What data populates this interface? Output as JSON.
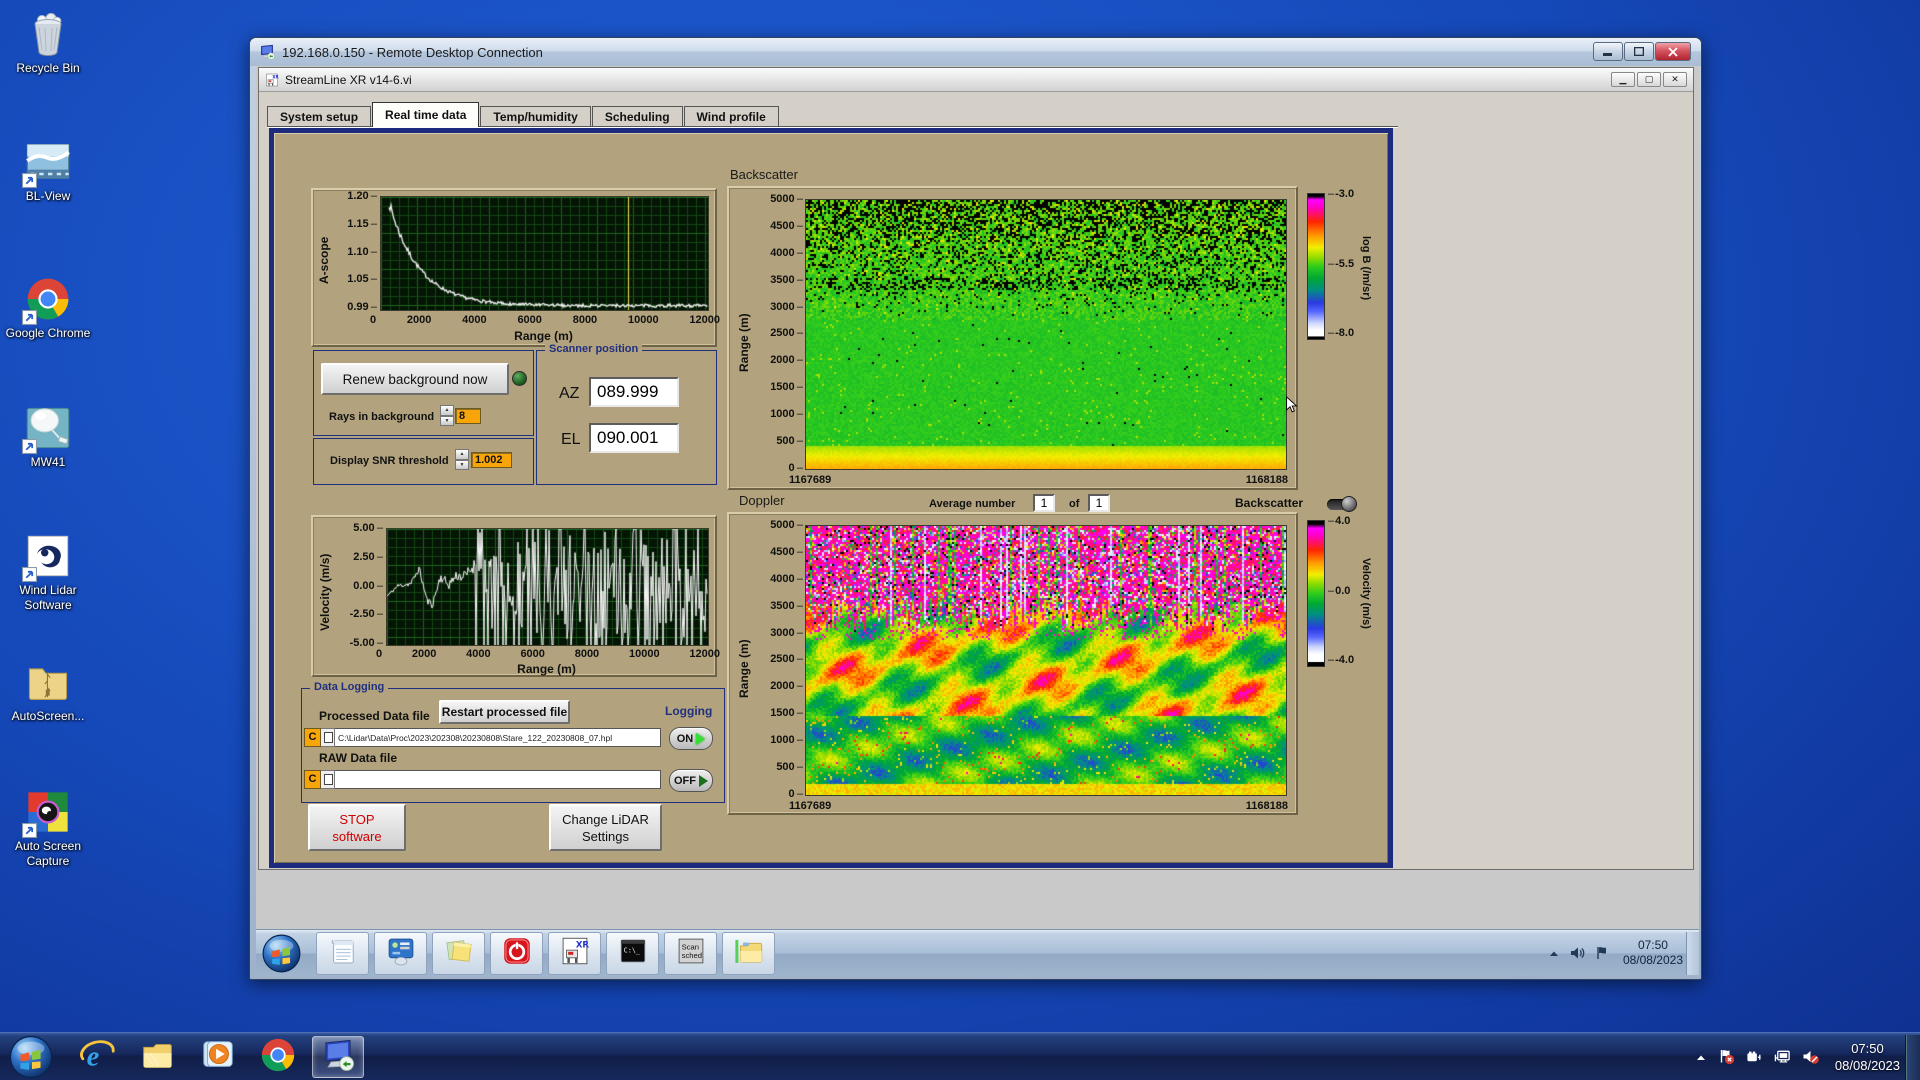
{
  "desktop": {
    "icons": [
      {
        "label": "Recycle Bin",
        "icon": "recycle-bin-icon",
        "shortcut": false,
        "top": 10
      },
      {
        "label": "BL-View",
        "icon": "bl-view-icon",
        "shortcut": true,
        "top": 138
      },
      {
        "label": "Google Chrome",
        "icon": "chrome-icon",
        "shortcut": true,
        "top": 275
      },
      {
        "label": "MW41",
        "icon": "mw41-icon",
        "shortcut": true,
        "top": 404
      },
      {
        "label": "Wind Lidar Software",
        "icon": "wind-lidar-icon",
        "shortcut": true,
        "top": 532
      },
      {
        "label": "AutoScreen...",
        "icon": "zip-folder-icon",
        "shortcut": false,
        "top": 658
      },
      {
        "label": "Auto Screen Capture",
        "icon": "auto-screen-capture-icon",
        "shortcut": true,
        "top": 788
      }
    ]
  },
  "rdp_window": {
    "title": "192.168.0.150 - Remote Desktop Connection",
    "minimize_label": "0",
    "maximize_label": "1",
    "close_label": "r"
  },
  "app_window": {
    "title": "StreamLine XR v14-6.vi",
    "tabs": [
      {
        "label": "System setup",
        "active": false
      },
      {
        "label": "Real time data",
        "active": true
      },
      {
        "label": "Temp/humidity",
        "active": false
      },
      {
        "label": "Scheduling",
        "active": false
      },
      {
        "label": "Wind profile",
        "active": false
      }
    ]
  },
  "ascope": {
    "ylabel": "A-scope",
    "yticks": [
      "1.20",
      "1.15",
      "1.10",
      "1.05",
      "0.99"
    ],
    "xticks": [
      "0",
      "2000",
      "4000",
      "6000",
      "8000",
      "10000",
      "12000"
    ],
    "xlabel": "Range (m)"
  },
  "background_controls": {
    "renew_button": "Renew background now",
    "rays_label": "Rays in background",
    "rays_value": "8",
    "snr_label": "Display SNR threshold",
    "snr_value": "1.002"
  },
  "scanner": {
    "title": "Scanner position",
    "az_label": "AZ",
    "az_value": "089.999",
    "el_label": "EL",
    "el_value": "090.001"
  },
  "backscatter": {
    "title": "Backscatter",
    "ylabel": "Range (m)",
    "yticks": [
      "5000",
      "4500",
      "4000",
      "3500",
      "3000",
      "2500",
      "2000",
      "1500",
      "1000",
      "500",
      "0"
    ],
    "x_start": "1167689",
    "x_end": "1168188",
    "colorbar": {
      "ticks": [
        "-3.0",
        "-5.5",
        "-8.0"
      ],
      "label": "log B (/m/sr)"
    }
  },
  "doppler": {
    "title": "Doppler",
    "avg_label": "Average number",
    "avg_value": "1",
    "of_label": "of",
    "of_count": "1",
    "toggle_label": "Backscatter",
    "ylabel": "Range (m)",
    "yticks": [
      "5000",
      "4500",
      "4000",
      "3500",
      "3000",
      "2500",
      "2000",
      "1500",
      "1000",
      "500",
      "0"
    ],
    "x_start": "1167689",
    "x_end": "1168188",
    "colorbar": {
      "ticks": [
        "4.0",
        "0.0",
        "-4.0"
      ],
      "label": "Velocity (m/s)"
    }
  },
  "velocity": {
    "ylabel": "Velocity (m/s)",
    "yticks": [
      "5.00",
      "2.50",
      "0.00",
      "-2.50",
      "-5.00"
    ],
    "xticks": [
      "0",
      "2000",
      "4000",
      "6000",
      "8000",
      "10000",
      "12000"
    ],
    "xlabel": "Range (m)"
  },
  "logging": {
    "title": "Data Logging",
    "processed_label": "Processed Data file",
    "restart_button": "Restart processed file",
    "logging_label": "Logging",
    "drive_letter": "C",
    "processed_path": "C:\\Lidar\\Data\\Proc\\2023\\202308\\20230808\\Stare_122_20230808_07.hpl",
    "on_label": "ON",
    "raw_label": "RAW Data file",
    "raw_path": "",
    "off_label": "OFF"
  },
  "actions": {
    "stop_line1": "STOP",
    "stop_line2": "software",
    "settings_line1": "Change LiDAR",
    "settings_line2": "Settings"
  },
  "remote_taskbar": {
    "buttons": [
      {
        "icon": "notepad-icon"
      },
      {
        "icon": "display-settings-icon"
      },
      {
        "icon": "sticky-notes-icon"
      },
      {
        "icon": "power-button-icon"
      },
      {
        "icon": "labview-xr-icon"
      },
      {
        "icon": "command-prompt-icon"
      },
      {
        "icon": "scan-sched-icon"
      },
      {
        "icon": "folder-icon"
      }
    ],
    "tray": {
      "time": "07:50",
      "date": "08/08/2023"
    }
  },
  "taskbar": {
    "buttons": [
      {
        "icon": "ie-icon",
        "active": false
      },
      {
        "icon": "explorer-icon",
        "active": false
      },
      {
        "icon": "media-player-icon",
        "active": false
      },
      {
        "icon": "chrome-icon",
        "active": false
      },
      {
        "icon": "rdp-icon",
        "active": true
      }
    ],
    "tray": {
      "time": "07:50",
      "date": "08/08/2023"
    }
  },
  "chart_data": [
    {
      "type": "line",
      "title": "A-scope",
      "xlabel": "Range (m)",
      "ylabel": "A-scope",
      "xlim": [
        0,
        12000
      ],
      "ylim": [
        0.99,
        1.2
      ],
      "x": [
        300,
        600,
        900,
        1200,
        1500,
        2000,
        2500,
        3000,
        4000,
        5000,
        6000,
        8000,
        10000,
        12000
      ],
      "y": [
        1.2,
        1.16,
        1.12,
        1.09,
        1.06,
        1.035,
        1.018,
        1.01,
        1.005,
        1.003,
        1.003,
        1.004,
        1.003,
        1.004
      ],
      "annotations": [
        "yellow cursor line at ~9300 m"
      ],
      "description": "Background intensity decays from 1.20 near range 0 to a noisy plateau ~1.00 beyond 2500 m"
    },
    {
      "type": "line",
      "title": "Velocity vs Range",
      "xlabel": "Range (m)",
      "ylabel": "Velocity (m/s)",
      "xlim": [
        0,
        12000
      ],
      "ylim": [
        -5,
        5
      ],
      "x": [
        0,
        500,
        1000,
        1300,
        1600,
        2000,
        2400,
        2800,
        3200
      ],
      "y": [
        -0.8,
        0.1,
        0.4,
        1.6,
        -1.5,
        0.9,
        0.4,
        1.0,
        1.8
      ],
      "description": "Coherent trace near 0 to +2 m/s below ~3300 m; beyond that uncorrelated noise saturating the full -5..+5 m/s scale (dense vertical lines)"
    },
    {
      "type": "heatmap",
      "title": "Backscatter",
      "x_range_labels": [
        "1167689",
        "1168188"
      ],
      "ylabel": "Range (m)",
      "ylim": [
        0,
        5000
      ],
      "zlabel": "log B (/m/sr)",
      "zlim": [
        -8.0,
        -3.0
      ],
      "colorbar_ticks": [
        -3.0,
        -5.5,
        -8.0
      ],
      "description": "Uniform green field ~-5.5 over 500-3000 m; speckled yellow-green with increasing black dropouts above 3000 m; bright yellow-gold band (~-4.5 to -4.2) below ~400 m"
    },
    {
      "type": "heatmap",
      "title": "Doppler",
      "x_range_labels": [
        "1167689",
        "1168188"
      ],
      "ylabel": "Range (m)",
      "ylim": [
        0,
        5000
      ],
      "zlabel": "Velocity (m/s)",
      "zlim": [
        -4.0,
        4.0
      ],
      "colorbar_ticks": [
        4.0,
        0.0,
        -4.0
      ],
      "description": "Magenta/pink noise with vertical streaks above ~3300 m; red/orange/yellow coherent updraft patches 1500-3000 m; green/cyan near-zero velocities with yellow patches below 1500 m"
    }
  ]
}
